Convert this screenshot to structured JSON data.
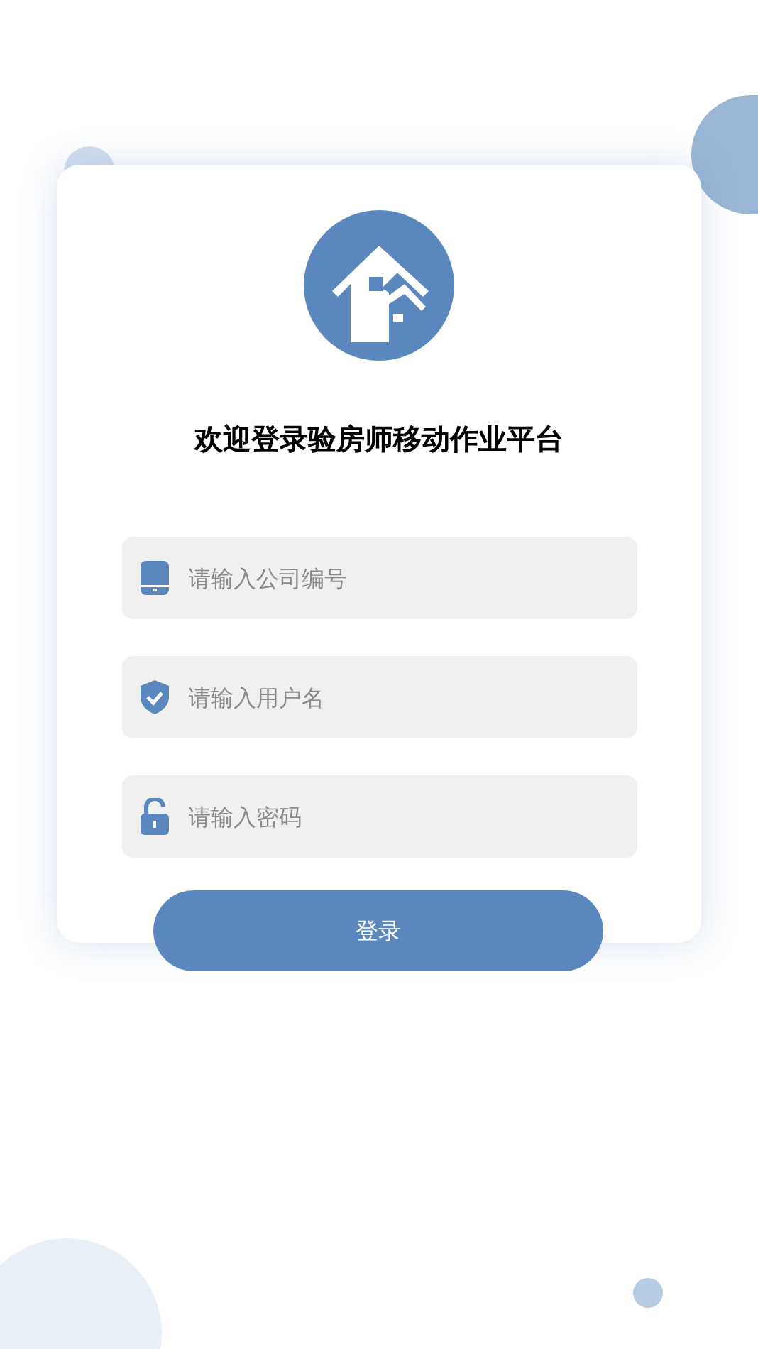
{
  "title": "欢迎登录验房师移动作业平台",
  "fields": [
    {
      "kind": "tablet",
      "placeholder": "请输入公司编号"
    },
    {
      "kind": "shield",
      "placeholder": "请输入用户名"
    },
    {
      "kind": "lock",
      "placeholder": "请输入密码"
    }
  ],
  "login_button": "登录"
}
